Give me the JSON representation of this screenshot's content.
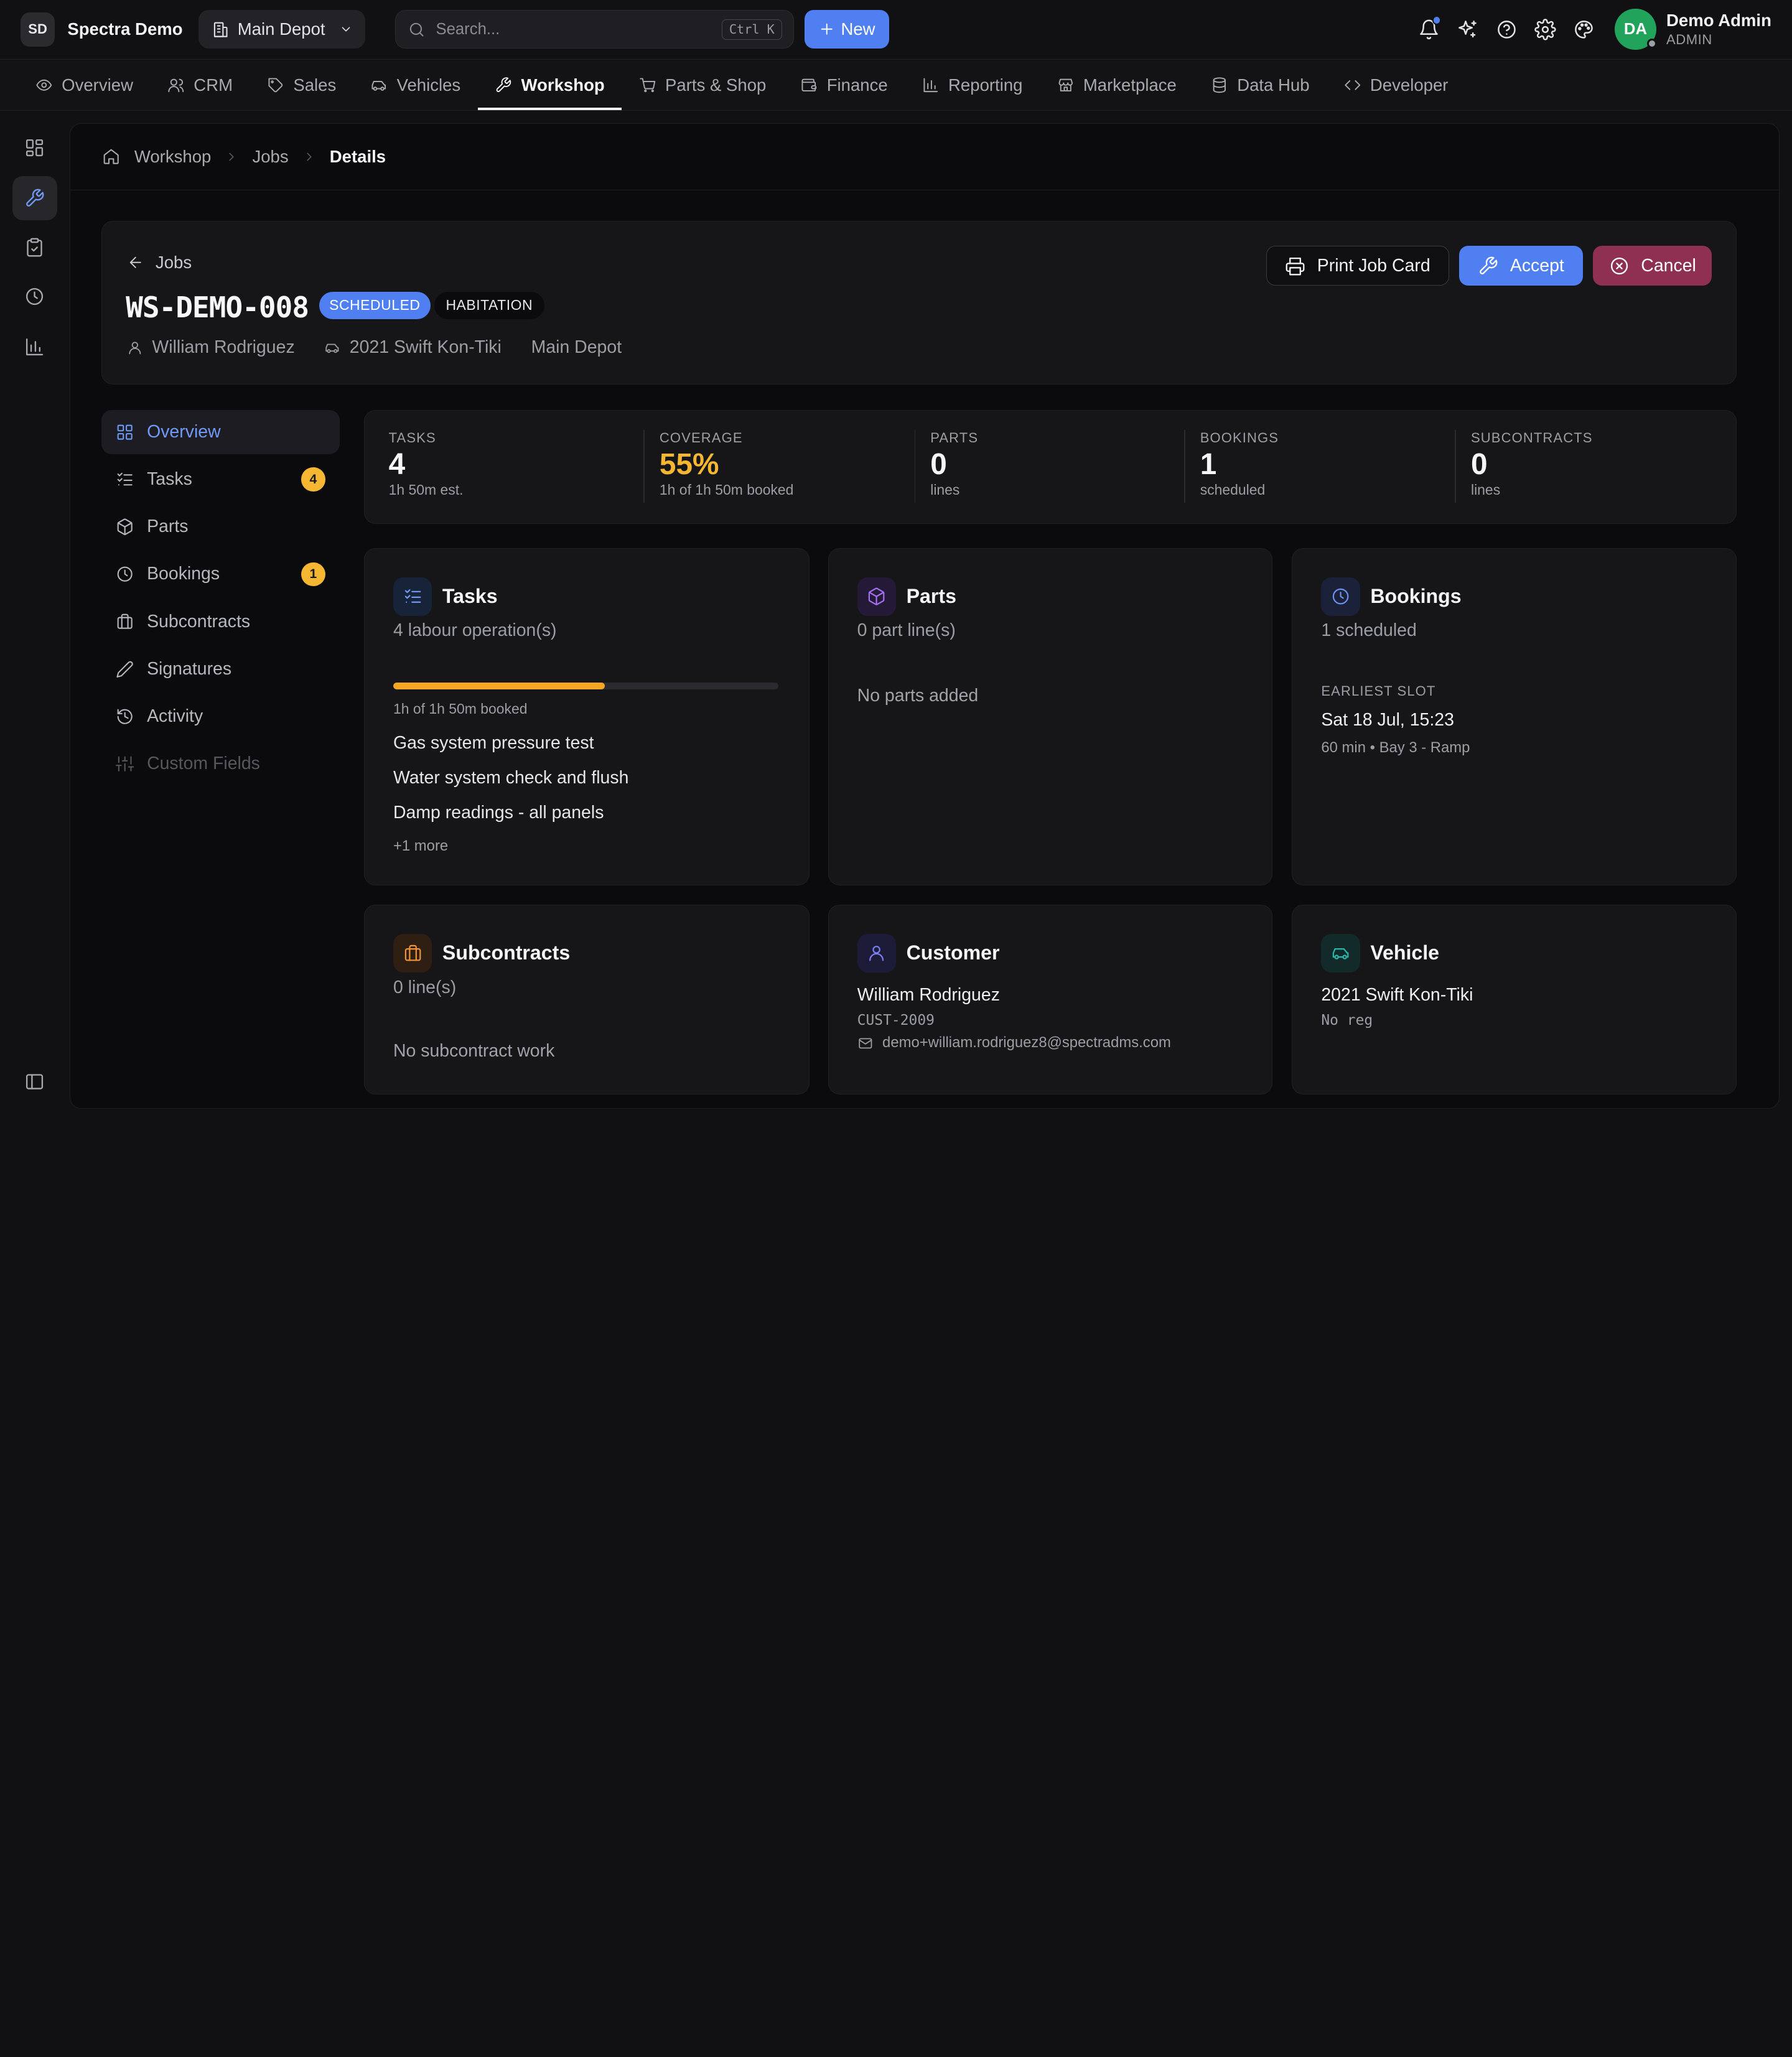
{
  "brand": {
    "initials": "SD",
    "name": "Spectra Demo"
  },
  "depot": {
    "selected": "Main Depot"
  },
  "search": {
    "placeholder": "Search...",
    "shortcut": "Ctrl K"
  },
  "new_button": {
    "label": "New"
  },
  "user": {
    "initials": "DA",
    "name": "Demo Admin",
    "role": "ADMIN"
  },
  "nav": {
    "tabs": [
      {
        "label": "Overview",
        "icon": "eye-icon"
      },
      {
        "label": "CRM",
        "icon": "users-icon"
      },
      {
        "label": "Sales",
        "icon": "tag-icon"
      },
      {
        "label": "Vehicles",
        "icon": "car-icon"
      },
      {
        "label": "Workshop",
        "icon": "wrench-icon",
        "active": true
      },
      {
        "label": "Parts & Shop",
        "icon": "cart-icon"
      },
      {
        "label": "Finance",
        "icon": "wallet-icon"
      },
      {
        "label": "Reporting",
        "icon": "bar-chart-icon"
      },
      {
        "label": "Marketplace",
        "icon": "store-icon"
      },
      {
        "label": "Data Hub",
        "icon": "database-icon"
      },
      {
        "label": "Developer",
        "icon": "code-icon"
      }
    ]
  },
  "breadcrumb": {
    "items": [
      "Workshop",
      "Jobs"
    ],
    "current": "Details"
  },
  "job": {
    "back_label": "Jobs",
    "id": "WS-DEMO-008",
    "status": "SCHEDULED",
    "type": "HABITATION",
    "customer": "William Rodriguez",
    "vehicle": "2021 Swift Kon-Tiki",
    "depot": "Main Depot"
  },
  "actions": {
    "print": "Print Job Card",
    "accept": "Accept",
    "cancel": "Cancel"
  },
  "subnav": {
    "items": [
      {
        "label": "Overview",
        "icon": "grid-icon",
        "active": true
      },
      {
        "label": "Tasks",
        "icon": "list-checks-icon",
        "count": "4"
      },
      {
        "label": "Parts",
        "icon": "box-icon"
      },
      {
        "label": "Bookings",
        "icon": "clock-icon",
        "count": "1"
      },
      {
        "label": "Subcontracts",
        "icon": "briefcase-icon"
      },
      {
        "label": "Signatures",
        "icon": "pen-icon"
      },
      {
        "label": "Activity",
        "icon": "history-icon"
      },
      {
        "label": "Custom Fields",
        "icon": "sliders-icon",
        "disabled": true
      }
    ]
  },
  "stats": [
    {
      "label": "TASKS",
      "value": "4",
      "sub": "1h 50m est."
    },
    {
      "label": "COVERAGE",
      "value": "55%",
      "sub": "1h of 1h 50m booked",
      "warn": true
    },
    {
      "label": "PARTS",
      "value": "0",
      "sub": "lines"
    },
    {
      "label": "BOOKINGS",
      "value": "1",
      "sub": "scheduled"
    },
    {
      "label": "SUBCONTRACTS",
      "value": "0",
      "sub": "lines"
    }
  ],
  "cards": {
    "tasks": {
      "title": "Tasks",
      "subtitle": "4 labour operation(s)",
      "progress": 0.55,
      "progress_note": "1h of 1h 50m booked",
      "items": [
        "Gas system pressure test",
        "Water system check and flush",
        "Damp readings - all panels"
      ],
      "more": "+1 more"
    },
    "parts": {
      "title": "Parts",
      "subtitle": "0 part line(s)",
      "empty": "No parts added"
    },
    "bookings": {
      "title": "Bookings",
      "subtitle": "1 scheduled",
      "slot_label": "EARLIEST SLOT",
      "slot_time": "Sat 18 Jul, 15:23",
      "slot_meta": "60 min • Bay 3 - Ramp"
    },
    "subcontracts": {
      "title": "Subcontracts",
      "subtitle": "0 line(s)",
      "empty": "No subcontract work"
    },
    "customer": {
      "title": "Customer",
      "name": "William Rodriguez",
      "code": "CUST-2009",
      "email": "demo+william.rodriguez8@spectradms.com"
    },
    "vehicle": {
      "title": "Vehicle",
      "name": "2021 Swift Kon-Tiki",
      "reg": "No reg"
    }
  },
  "colors": {
    "accent": "#4f7ff0",
    "warning": "#f5b731",
    "danger": "#8f2f52",
    "success": "#22a35b"
  }
}
